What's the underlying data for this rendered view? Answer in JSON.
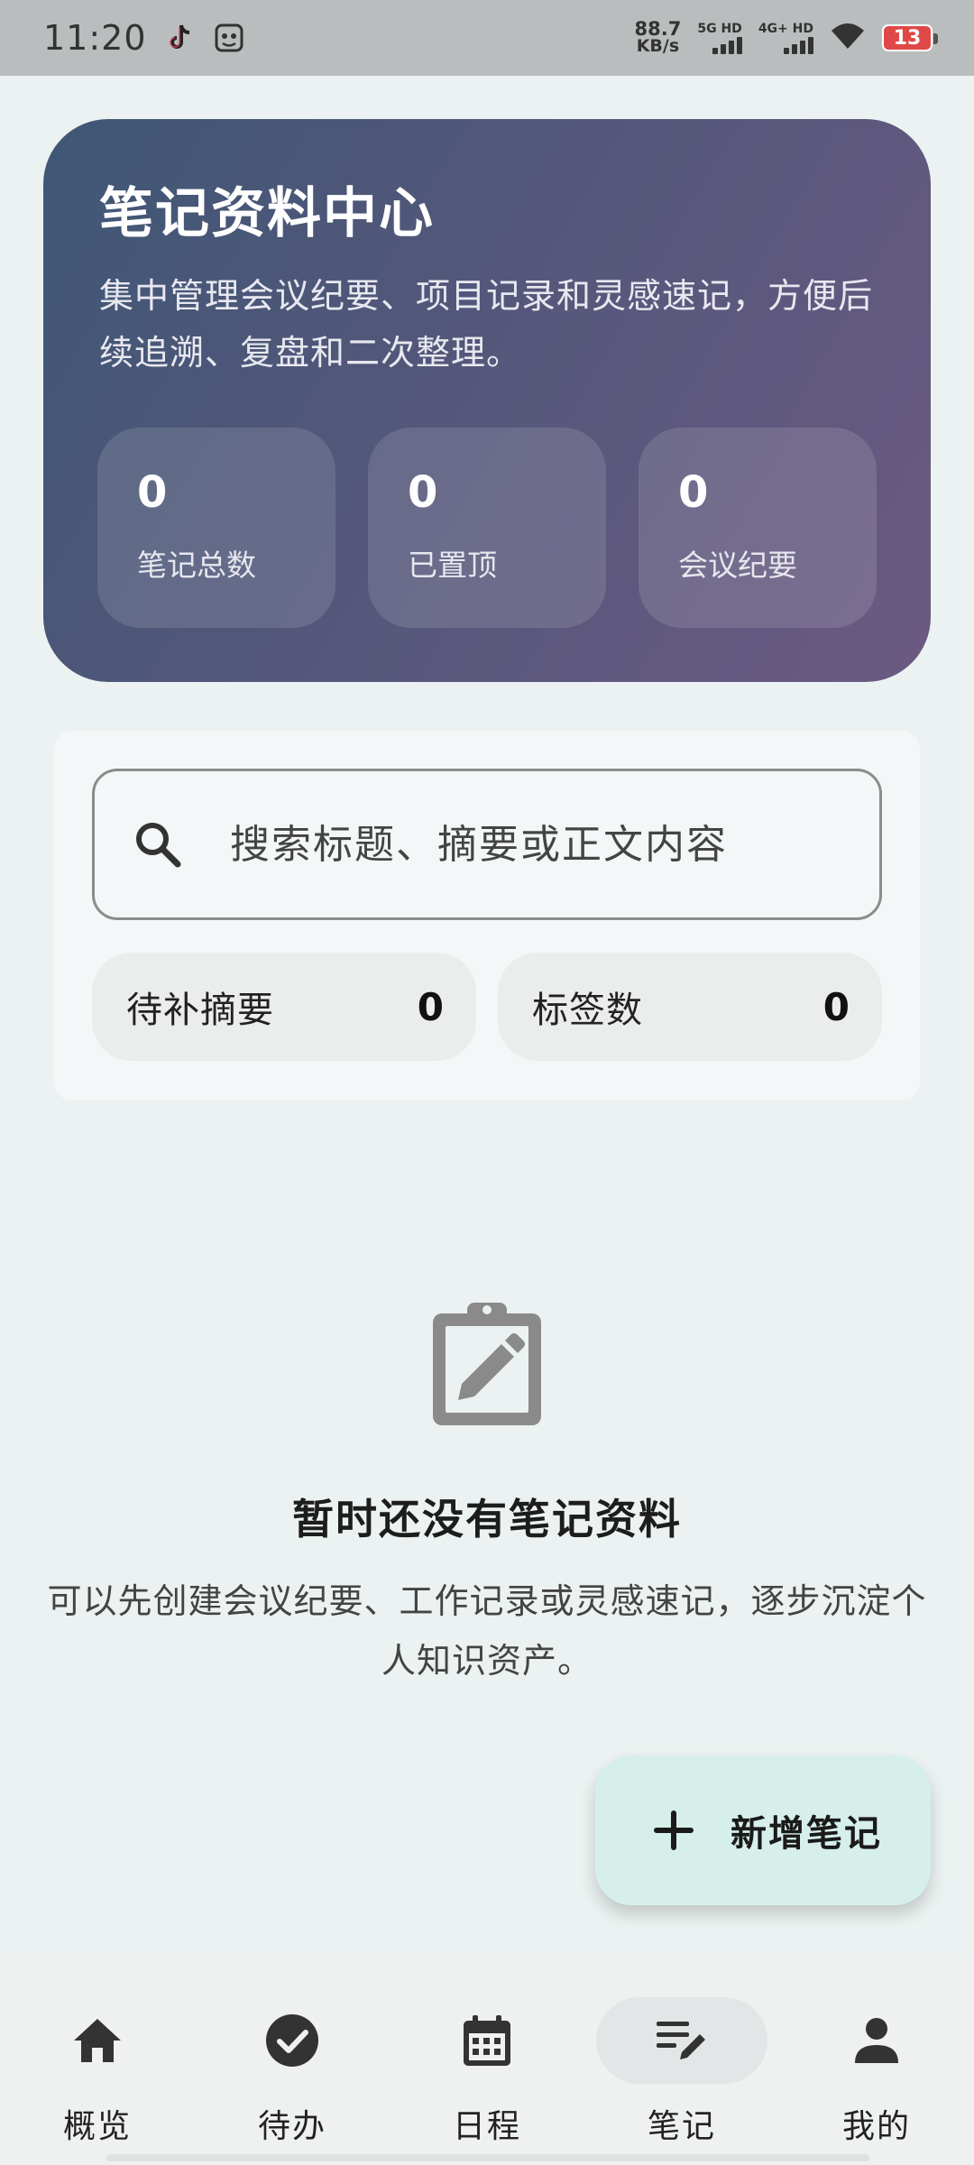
{
  "status_bar": {
    "time": "11:20",
    "net_speed_value": "88.7",
    "net_speed_unit": "KB/s",
    "sim1_label": "5G HD",
    "sim2_label": "4G+ HD",
    "battery": "13",
    "battery_color": "#e04848",
    "icons": [
      "tiktok-icon",
      "app-icon",
      "wifi-icon"
    ]
  },
  "hero": {
    "title": "笔记资料中心",
    "description": "集中管理会议纪要、项目记录和灵感速记，方便后续追溯、复盘和二次整理。",
    "stats": [
      {
        "value": "0",
        "label": "笔记总数"
      },
      {
        "value": "0",
        "label": "已置顶"
      },
      {
        "value": "0",
        "label": "会议纪要"
      }
    ]
  },
  "search": {
    "placeholder": "搜索标题、摘要或正文内容",
    "value": ""
  },
  "chips": [
    {
      "label": "待补摘要",
      "value": "0"
    },
    {
      "label": "标签数",
      "value": "0"
    }
  ],
  "empty_state": {
    "icon": "clipboard-edit-icon",
    "title": "暂时还没有笔记资料",
    "description": "可以先创建会议纪要、工作记录或灵感速记，逐步沉淀个人知识资产。"
  },
  "fab": {
    "label": "新增笔记",
    "icon": "plus-icon"
  },
  "bottom_nav": {
    "items": [
      {
        "label": "概览",
        "icon": "home-icon"
      },
      {
        "label": "待办",
        "icon": "check-circle-icon"
      },
      {
        "label": "日程",
        "icon": "calendar-icon"
      },
      {
        "label": "笔记",
        "icon": "notes-edit-icon",
        "active": true
      },
      {
        "label": "我的",
        "icon": "person-icon"
      }
    ]
  },
  "colors": {
    "hero_gradient_start": "#3f5775",
    "hero_gradient_end": "#6b5a82",
    "background": "#ebf2f1",
    "fab_background": "#d6efeb"
  }
}
